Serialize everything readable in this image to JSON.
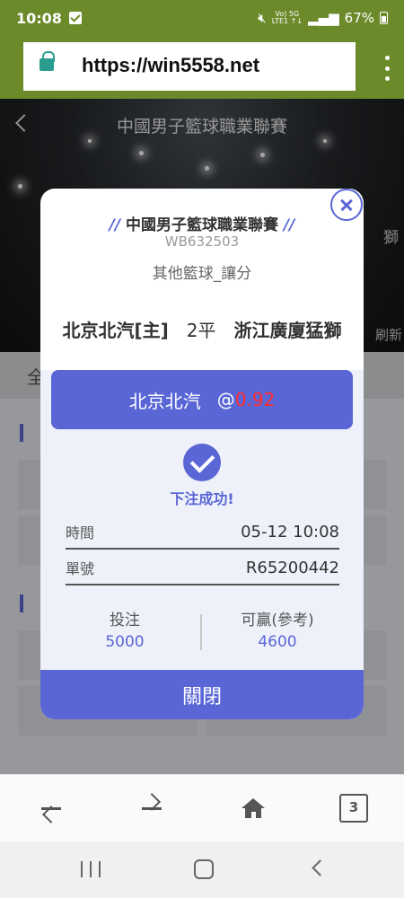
{
  "status_bar": {
    "time": "10:08",
    "signal_top": "Vo) 5G",
    "signal_bottom": "LTE1 ↑↓",
    "battery": "67%"
  },
  "browser": {
    "url": "https://win5558.net",
    "tab_count": "3"
  },
  "page": {
    "title": "中國男子籃球職業聯賽",
    "side_text_1": "獅",
    "side_text_2": "刷新",
    "tab_label": "全"
  },
  "modal": {
    "league": "中國男子籃球職業聯賽",
    "league_prefix": "//",
    "league_suffix": "//",
    "code": "WB632503",
    "bet_type": "其他籃球_讓分",
    "home_team": "北京北汽[主]",
    "handicap": "2平",
    "away_team": "浙江廣廈猛獅",
    "pick_team": "北京北汽",
    "pick_at": "@",
    "pick_odds": "0.92",
    "success_text": "下注成功!",
    "time_label": "時間",
    "time_value": "05-12 10:08",
    "ticket_label": "單號",
    "ticket_value": "R65200442",
    "stake_label": "投注",
    "stake_value": "5000",
    "win_label": "可贏(參考)",
    "win_value": "4600",
    "close_label": "關閉"
  },
  "colors": {
    "accent": "#5a66d6",
    "odds": "#ff2a2a",
    "status_bar": "#6b8a2a",
    "url_lock": "#2a9d8f"
  }
}
